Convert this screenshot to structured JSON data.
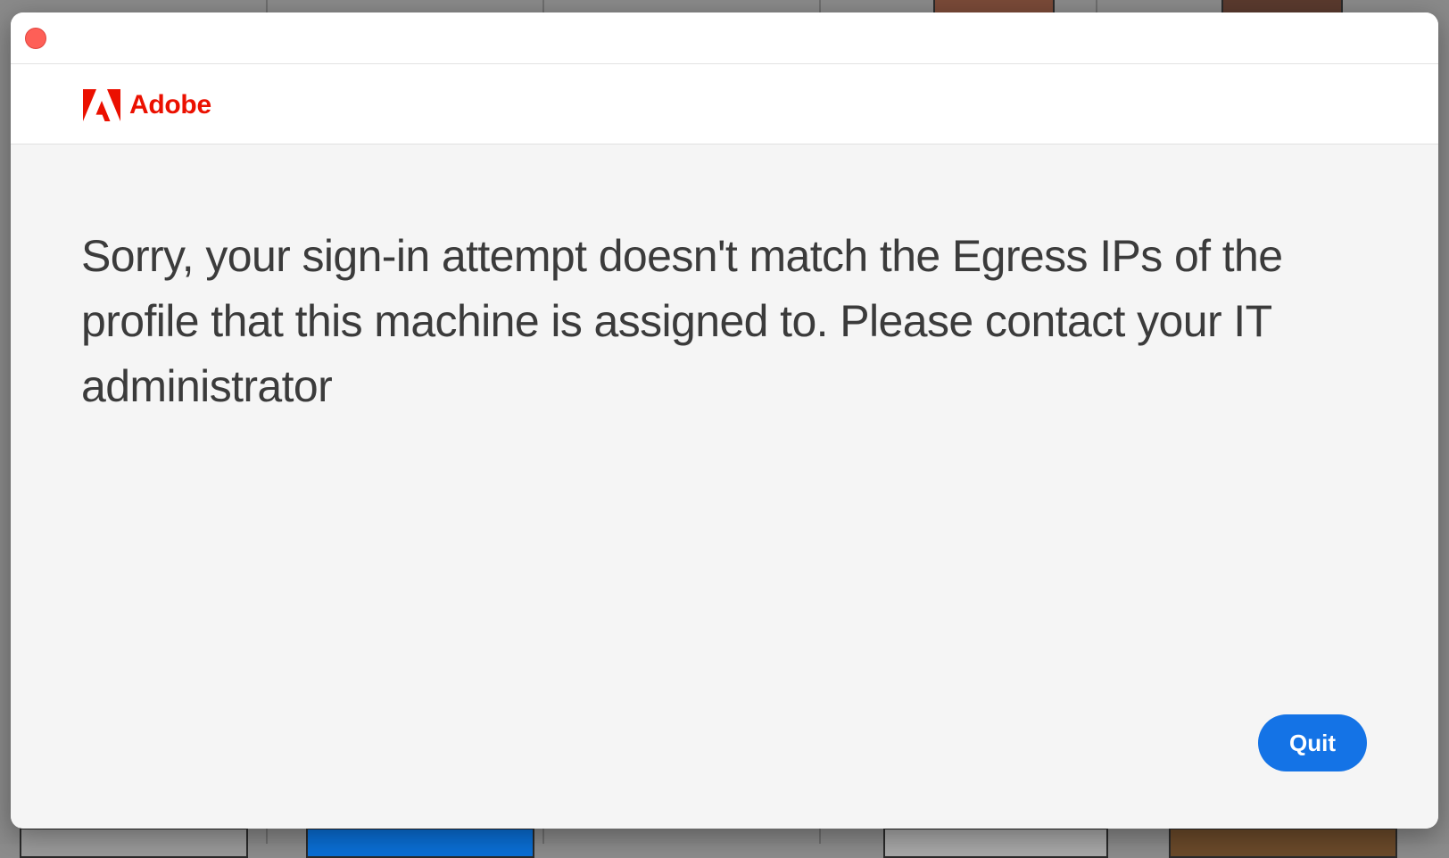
{
  "dialog": {
    "brand_name": "Adobe",
    "brand_color": "#eb1000",
    "logo_icon": "adobe-logo-icon",
    "close_icon": "close-icon",
    "message": "Sorry, your sign-in attempt doesn't match the Egress IPs of the profile that this machine is assigned to. Please contact your IT administrator",
    "quit_label": "Quit",
    "accent_color": "#1473e6"
  }
}
